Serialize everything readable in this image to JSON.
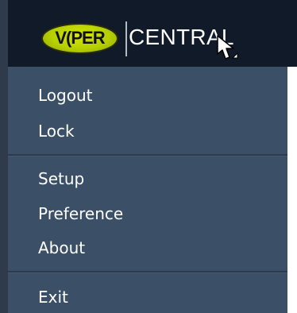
{
  "brand": {
    "logo_text": "V(PER",
    "product_text": "CENTRAL"
  },
  "menu": {
    "items": [
      {
        "label": "Logout"
      },
      {
        "label": "Lock"
      },
      {
        "label": "Setup"
      },
      {
        "label": "Preference"
      },
      {
        "label": "About"
      },
      {
        "label": "Exit"
      }
    ]
  },
  "colors": {
    "header_bg": "#111a28",
    "menu_bg": "#3b4f67",
    "logo_yellow": "#c7db00"
  },
  "icons": {
    "cursor": "mouse-pointer-icon"
  }
}
